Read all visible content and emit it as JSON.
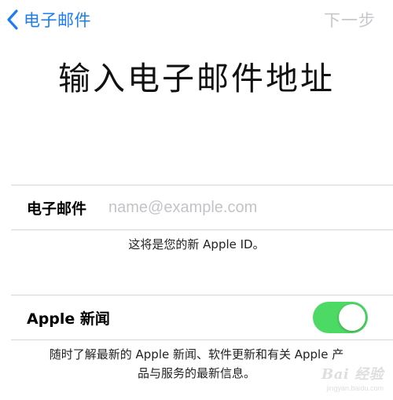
{
  "nav": {
    "back_label": "电子邮件",
    "next_label": "下一步"
  },
  "title": "输入电子邮件地址",
  "email_field": {
    "label": "电子邮件",
    "value": "",
    "placeholder": "name@example.com"
  },
  "email_hint": "这将是您的新 Apple ID。",
  "apple_news": {
    "label": "Apple 新闻",
    "toggle_on": true,
    "description_line1": "随时了解最新的 Apple 新闻、软件更新和有关 Apple 产",
    "description_line2": "品与服务的最新信息。"
  },
  "colors": {
    "accent": "#1d7cf2",
    "toggle_on": "#4cd964",
    "disabled_text": "#c8c8cc",
    "divider": "#d6d6d9"
  },
  "icons": {
    "back": "chevron-left-icon"
  },
  "watermark": {
    "main": "Bai 经验",
    "sub": "jingyan.baidu.com"
  }
}
